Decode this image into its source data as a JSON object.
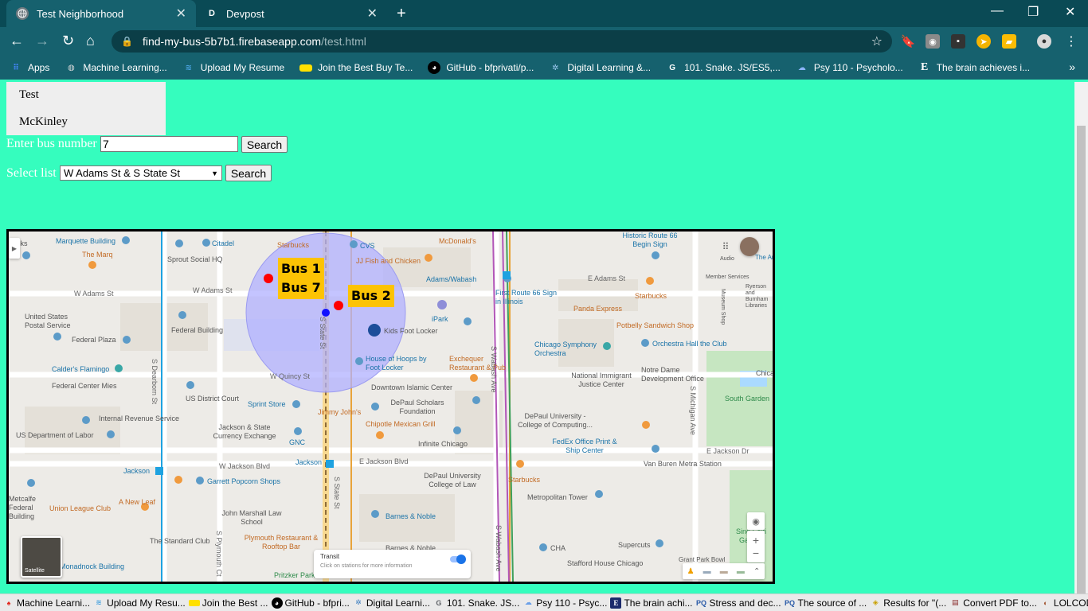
{
  "browser": {
    "tabs": [
      {
        "title": "Test Neighborhood",
        "favicon": "globe-icon",
        "active": true
      },
      {
        "title": "Devpost",
        "favicon": "D",
        "active": false
      }
    ],
    "url_host": "find-my-bus-5b7b1.firebaseapp.com",
    "url_path": "/test.html",
    "bookmarks": [
      {
        "label": "Apps",
        "icon": "apps-grid-icon",
        "color": "#4285F4"
      },
      {
        "label": "Machine Learning...",
        "icon": "globe-icon",
        "color": "#5f6368"
      },
      {
        "label": "Upload My Resume",
        "icon": "database-icon",
        "color": "#4aa3df"
      },
      {
        "label": "Join the Best Buy Te...",
        "icon": "best-buy-icon",
        "color": "#FFE000"
      },
      {
        "label": "GitHub - bfprivati/p...",
        "icon": "github-icon",
        "color": "#000000"
      },
      {
        "label": "Digital Learning &...",
        "icon": "sparkle-icon",
        "color": "#3d7fc1"
      },
      {
        "label": "101. Snake. JS/ES5,...",
        "icon": "google-icon",
        "color": "#5f6368"
      },
      {
        "label": "Psy 110 - Psycholo...",
        "icon": "cloud-icon",
        "color": "#8ab4f8"
      },
      {
        "label": "The brain achieves i...",
        "icon": "e-icon",
        "color": "#1c2a6b"
      }
    ]
  },
  "page": {
    "nav_links": [
      "Test",
      "McKinley"
    ],
    "bus_label": "Enter bus number",
    "bus_value": "7",
    "search_label": "Search",
    "list_label": "Select list",
    "list_selected": "W Adams St & S State St",
    "search2_label": "Search"
  },
  "map": {
    "bus_tags": {
      "left": [
        "Bus 1",
        "Bus 7"
      ],
      "right": "Bus 2"
    },
    "labels": [
      "Marquette Building",
      "Citadel",
      "Starbucks",
      "CVS",
      "McDonald's",
      "Historic Route 66 Begin Sign",
      "The Marq",
      "Sprout Social HQ",
      "JJ Fish and Chicken",
      "Adams/Wabash",
      "E Adams St",
      "Audio",
      "The Art Institute",
      "W Adams St",
      "W Adams St",
      "Member Services",
      "First Route 66 Sign in Illinois",
      "Starbucks",
      "Panda Express",
      "Museum Shop",
      "Ryerson and Burnham Libraries",
      "United States Postal Service",
      "Federal Building",
      "iPark",
      "Kids Foot Locker",
      "Potbelly Sandwich Shop",
      "Federal Plaza",
      "Chicago Symphony Orchestra",
      "Orchestra Hall the Club",
      "House of Hoops by Foot Locker",
      "Exchequer Restaurant & Pub",
      "Calder's Flamingo",
      "W Quincy St",
      "National Immigrant Justice Center",
      "Notre Dame Development Office",
      "Federal Center Mies",
      "Downtown Islamic Center",
      "US District Court",
      "South Garden",
      "Sprint Store",
      "Jimmy John's",
      "DePaul Scholars Foundation",
      "Internal Revenue Service",
      "DePaul University - College of Computing...",
      "Jackson & State Currency Exchange",
      "US Department of Labor",
      "Chipotle Mexican Grill",
      "GNC",
      "Infinite Chicago",
      "FedEx Office Print & Ship Center",
      "E Jackson Dr",
      "Jackson",
      "W Jackson Blvd",
      "Jackson",
      "E Jackson Blvd",
      "Van Buren Metra Station",
      "Garrett Popcorn Shops",
      "DePaul University College of Law",
      "Starbucks",
      "Metcalfe Federal Building",
      "A New Leaf",
      "Metropolitan Tower",
      "Union League Club",
      "John Marshall Law School",
      "Barnes & Noble",
      "The Standard Club",
      "Plymouth Restaurant & Rooftop Bar",
      "Barnes & Noble",
      "CHA",
      "Supercuts",
      "Grant Park Bowl",
      "Sing Solti Garden",
      "Stafford House Chicago",
      "Monadnock Building",
      "Pritzker Park",
      "Chicago",
      "Lucks"
    ],
    "streets": [
      "S Dearborn St",
      "S Plymouth Ct",
      "S State St",
      "S State St",
      "S Wabash Ave",
      "S Wabash Ave",
      "S Michigan Ave"
    ],
    "transit_title": "Transit",
    "transit_sub": "Click on stations for more information",
    "satellite_label": "Satellite"
  },
  "taskbar": [
    {
      "label": "Machine Learni...",
      "icon": "adobe-icon",
      "color": "#e1261c"
    },
    {
      "label": "Upload My Resu...",
      "icon": "database-icon",
      "color": "#4aa3df"
    },
    {
      "label": "Join the Best ...",
      "icon": "best-buy-icon",
      "color": "#FFE000"
    },
    {
      "label": "GitHub - bfpri...",
      "icon": "github-icon",
      "color": "#000000"
    },
    {
      "label": "Digital Learni...",
      "icon": "sparkle-icon",
      "color": "#3d7fc1"
    },
    {
      "label": "101. Snake. JS...",
      "icon": "google-icon",
      "color": "#5f6368"
    },
    {
      "label": "Psy 110 - Psyc...",
      "icon": "cloud-icon",
      "color": "#8ab4f8"
    },
    {
      "label": "The brain achi...",
      "icon": "e-icon",
      "color": "#1c2a6b"
    },
    {
      "label": "Stress and dec...",
      "icon": "pq-icon",
      "color": "#2a5ba8"
    },
    {
      "label": "The source of ...",
      "icon": "pq-icon",
      "color": "#2a5ba8"
    },
    {
      "label": "Results for \"(...",
      "icon": "results-icon",
      "color": "#c8a000"
    },
    {
      "label": "Convert PDF to...",
      "icon": "pdf-icon",
      "color": "#8a2c2c"
    },
    {
      "label": "LOLCODE",
      "icon": "lolcode-icon",
      "color": "#a0522d"
    }
  ],
  "colors": {
    "page_bg": "#35FDBE",
    "chrome_dark": "#0A4A55",
    "chrome": "#16616E",
    "bus_tag": "#FCC304",
    "bus_marker": "#FF0000",
    "radius_circle": "#B0B0FF"
  }
}
